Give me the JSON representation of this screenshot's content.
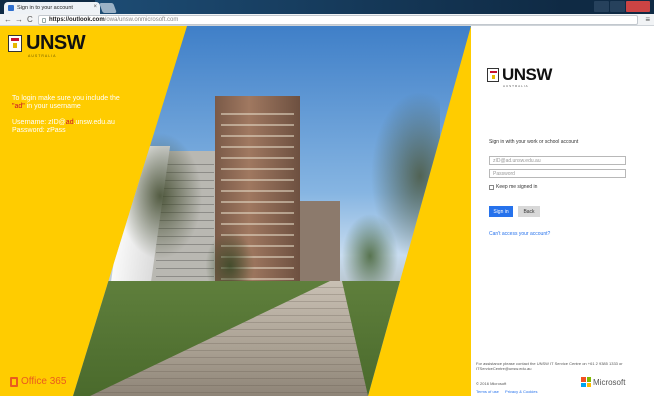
{
  "browser": {
    "tab_title": "Sign in to your account",
    "tab_close": "×",
    "url_domain": "https://outlook.com",
    "url_path": "/owa/unsw.onmicrosoft.com",
    "back": "←",
    "forward": "→",
    "reload": "C",
    "menu": "≡"
  },
  "left_panel": {
    "logo_name": "UNSW",
    "logo_sub": "AUSTRALIA",
    "line1": "To login make sure you include the",
    "quoted_ad": "\"ad\"",
    "line2": " in your username",
    "username_label": "Username: zID@",
    "username_ad": "ad",
    "username_suffix": ".unsw.edu.au",
    "password_hint": "Password: zPass",
    "office": "Office 365"
  },
  "signin": {
    "logo_name": "UNSW",
    "logo_sub": "AUSTRALIA",
    "prompt": "Sign in with your work or school account",
    "username_placeholder": "zID@ad.unsw.edu.au",
    "password_placeholder": "Password",
    "keep_signed_in": "Keep me signed in",
    "signin_button": "Sign in",
    "back_button": "Back",
    "cant_access": "Can't access your account?",
    "assistance": "For assistance please contact the UNSW IT Service Centre on +61 2 9385 1333 or ITServiceCentre@unsw.edu.au",
    "copyright": "© 2016 Microsoft",
    "terms": "Terms of use",
    "privacy": "Privacy & Cookies",
    "microsoft": "Microsoft"
  },
  "colors": {
    "unsw_yellow": "#ffcc00",
    "accent_red": "#c8102e",
    "signin_blue": "#2672ec",
    "office_orange": "#ea5b1e"
  }
}
